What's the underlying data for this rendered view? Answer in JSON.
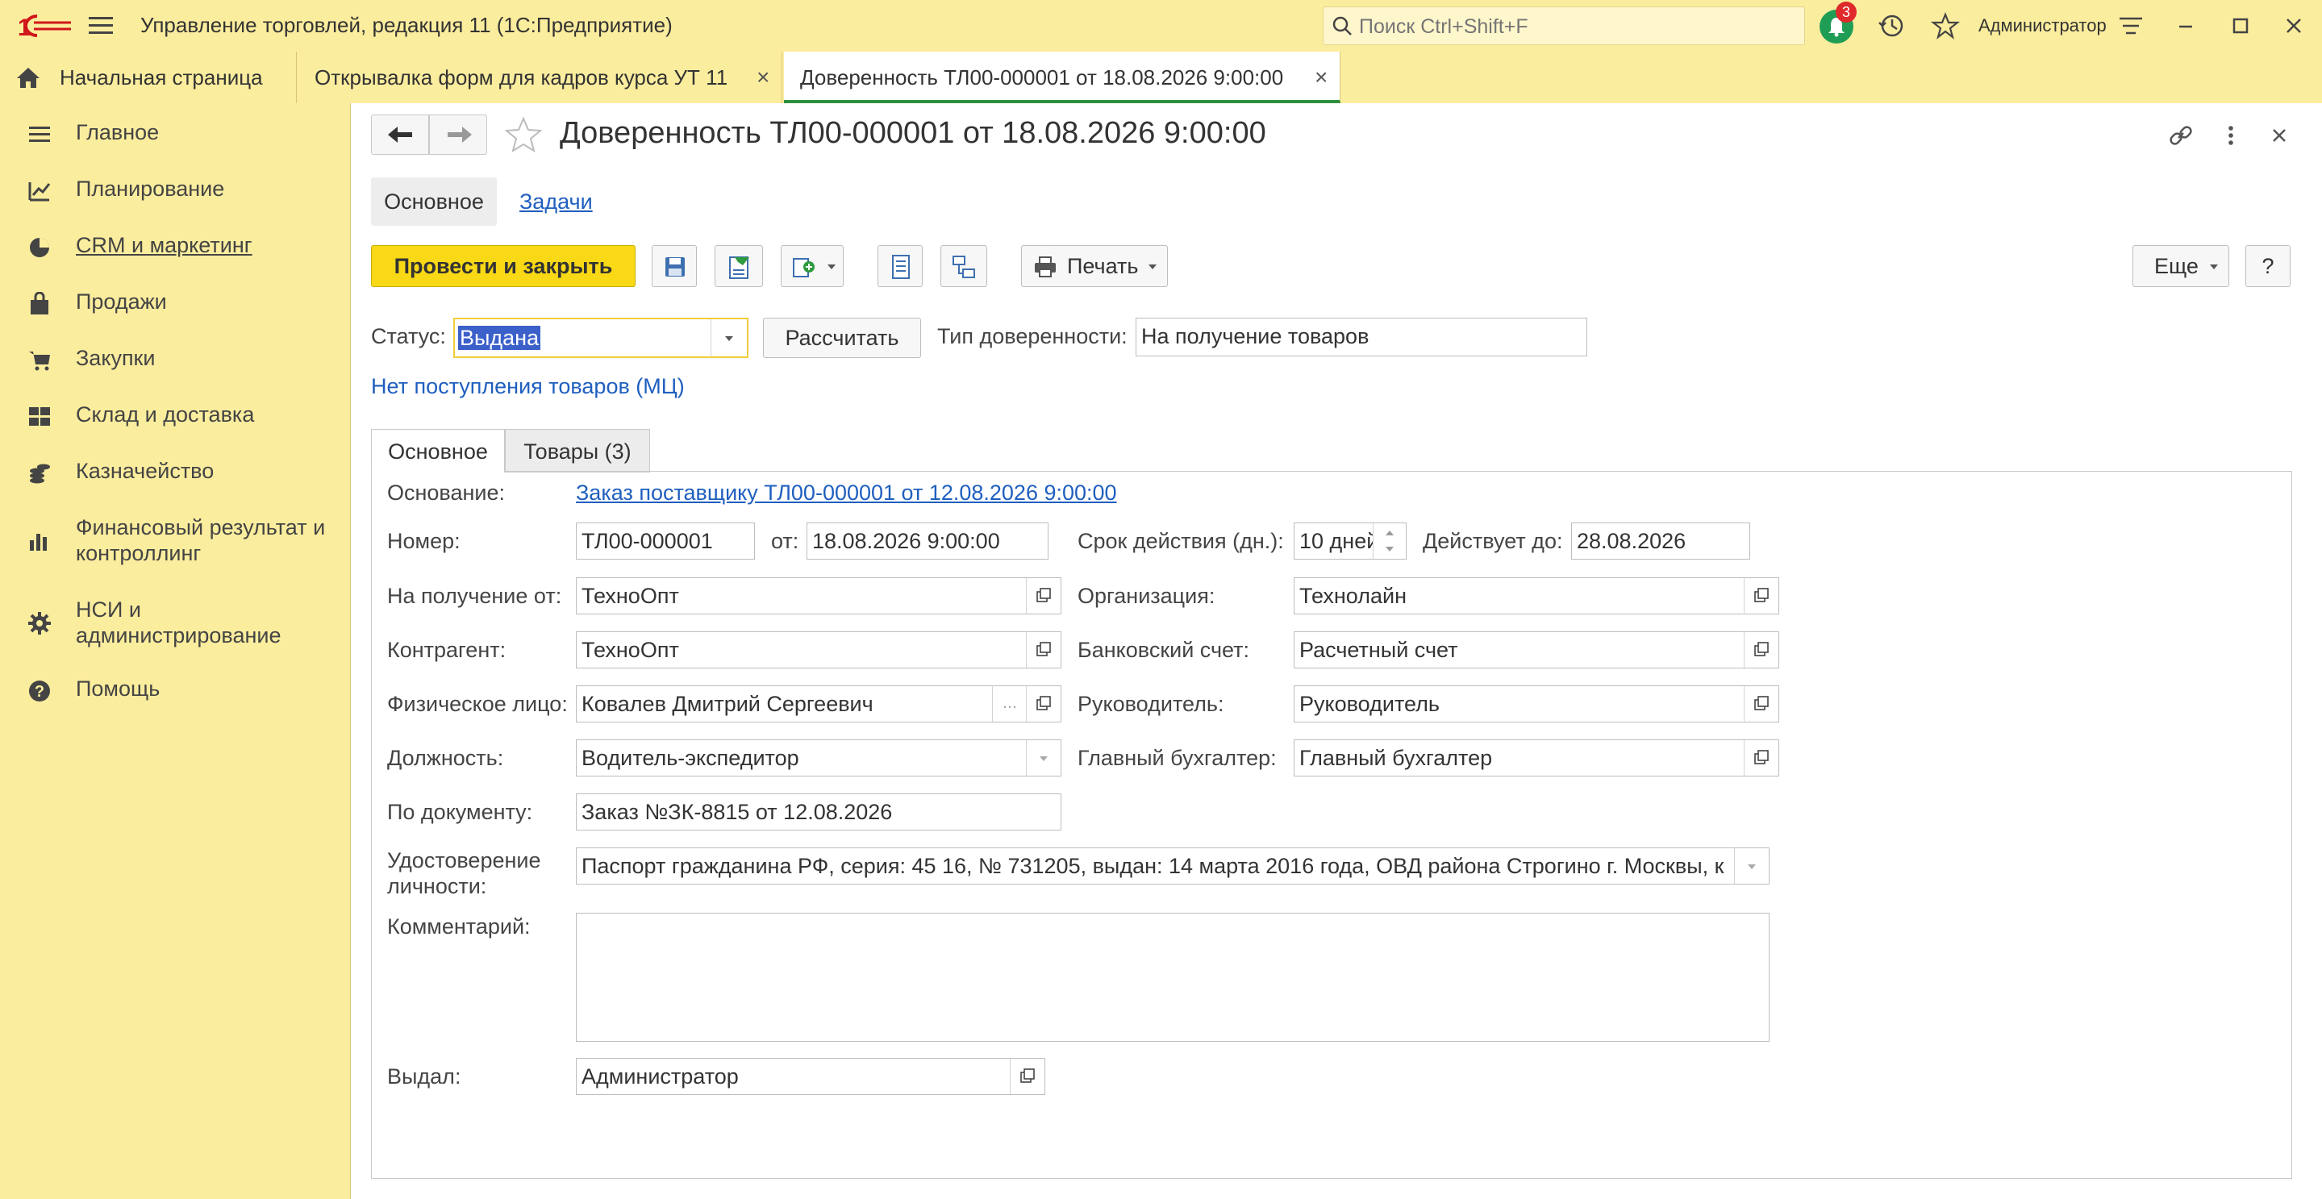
{
  "app": {
    "title": "Управление торговлей, редакция 11  (1С:Предприятие)",
    "search_placeholder": "Поиск Ctrl+Shift+F",
    "notifications_count": "3",
    "user": "Администратор"
  },
  "tabs": [
    {
      "label": "Начальная страница"
    },
    {
      "label": "Открывалка форм для кадров курса УТ 11"
    },
    {
      "label": "Доверенность ТЛ00-000001 от 18.08.2026 9:00:00"
    }
  ],
  "sidebar": {
    "items": [
      {
        "label": "Главное",
        "icon": "menu-lines-icon"
      },
      {
        "label": "Планирование",
        "icon": "planning-icon"
      },
      {
        "label": "CRM и маркетинг",
        "icon": "pie-chart-icon"
      },
      {
        "label": "Продажи",
        "icon": "bag-icon"
      },
      {
        "label": "Закупки",
        "icon": "cart-icon"
      },
      {
        "label": "Склад и доставка",
        "icon": "warehouse-icon"
      },
      {
        "label": "Казначейство",
        "icon": "coins-icon"
      },
      {
        "label": "Финансовый результат и",
        "label2": "контроллинг",
        "icon": "bar-chart-icon"
      },
      {
        "label": "НСИ и",
        "label2": "администрирование",
        "icon": "gear-icon"
      },
      {
        "label": "Помощь",
        "icon": "help-icon"
      }
    ]
  },
  "document": {
    "title": "Доверенность ТЛ00-000001 от 18.08.2026 9:00:00",
    "subtabs": {
      "main": "Основное",
      "tasks": "Задачи"
    },
    "toolbar": {
      "post_close": "Провести и закрыть",
      "print": "Печать",
      "more": "Еще",
      "help": "?"
    },
    "status_label": "Статус:",
    "status_value": "Выдана",
    "calculate": "Рассчитать",
    "type_label": "Тип доверенности:",
    "type_value": "На получение товаров",
    "no_receipts_link": "Нет поступления товаров (МЦ)",
    "page_tabs": {
      "main": "Основное",
      "goods": "Товары (3)"
    }
  },
  "form": {
    "basis_label": "Основание:",
    "basis_link": "Заказ поставщику ТЛ00-000001 от 12.08.2026 9:00:00",
    "number_label": "Номер:",
    "number_value": "ТЛ00-000001",
    "from_label": "от:",
    "from_value": "18.08.2026  9:00:00",
    "term_label": "Срок действия (дн.):",
    "term_value": "10 дней",
    "valid_to_label": "Действует до:",
    "valid_to_value": "28.08.2026",
    "receive_from_label": "На получение от:",
    "receive_from_value": "ТехноОпт",
    "org_label": "Организация:",
    "org_value": "Технолайн",
    "counterparty_label": "Контрагент:",
    "counterparty_value": "ТехноОпт",
    "bank_label": "Банковский счет:",
    "bank_value": "Расчетный счет",
    "person_label": "Физическое лицо:",
    "person_value": "Ковалев Дмитрий Сергеевич",
    "head_label": "Руководитель:",
    "head_value": "Руководитель",
    "position_label": "Должность:",
    "position_value": "Водитель-экспедитор",
    "accountant_label": "Главный бухгалтер:",
    "accountant_value": "Главный бухгалтер",
    "by_doc_label": "По документу:",
    "by_doc_value": "Заказ №ЗК-8815 от 12.08.2026",
    "id_label_1": "Удостоверение",
    "id_label_2": "личности:",
    "id_value": "Паспорт гражданина РФ, серия: 45 16, № 731205, выдан: 14 марта 2016 года, ОВД района Строгино г. Москвы, к",
    "comment_label": "Комментарий:",
    "comment_value": "",
    "issued_label": "Выдал:",
    "issued_value": "Администратор"
  }
}
